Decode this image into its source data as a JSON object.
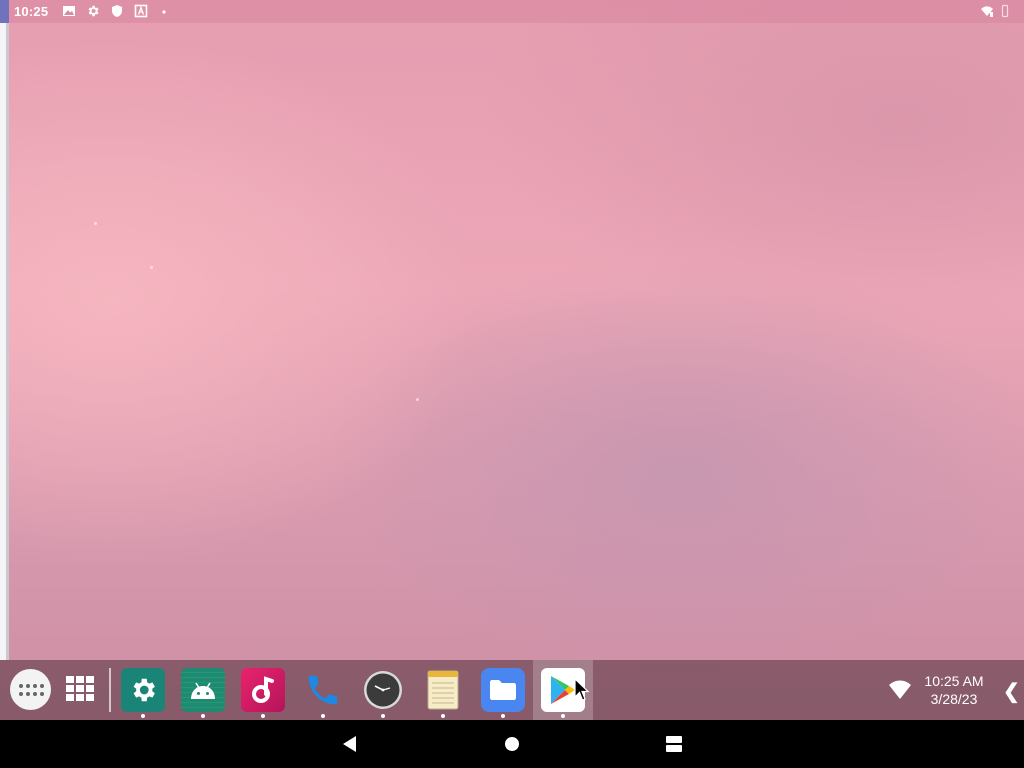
{
  "status_bar": {
    "time": "10:25",
    "left_icons": [
      "image-icon",
      "gear-icon",
      "shield-icon",
      "keyboard-a-icon",
      "dot-icon"
    ],
    "right_icons": [
      "wifi-signal-icon",
      "battery-icon"
    ]
  },
  "taskbar": {
    "launcher_icon": "app-drawer-icon",
    "recents_icon": "grid-icon",
    "apps": [
      {
        "name": "Settings",
        "icon": "gear-icon",
        "color": "#1a8577",
        "running": true
      },
      {
        "name": "Android",
        "icon": "android-icon",
        "color": "#1e8a6f",
        "running": true
      },
      {
        "name": "Music",
        "icon": "music-icon",
        "color": "#d8206a",
        "running": true
      },
      {
        "name": "Phone",
        "icon": "phone-icon",
        "color": "#1e88e5",
        "running": true
      },
      {
        "name": "Clock",
        "icon": "clock-icon",
        "color": "#3a3a3a",
        "running": true
      },
      {
        "name": "Notes",
        "icon": "notepad-icon",
        "color": "#f5e7b0",
        "running": true
      },
      {
        "name": "Files",
        "icon": "folder-icon",
        "color": "#4a86f0",
        "running": true
      },
      {
        "name": "Play Store",
        "icon": "play-store-icon",
        "color": "#ffffff",
        "running": true,
        "active": true
      }
    ],
    "clock_time": "10:25 AM",
    "clock_date": "3/28/23",
    "expand_glyph": "❮"
  },
  "nav_bar": {
    "buttons": [
      "back-icon",
      "home-icon",
      "recents-icon"
    ]
  },
  "colors": {
    "wallpaper": "#e8a0b4",
    "taskbar": "#6e4655",
    "navbar": "#000000"
  }
}
